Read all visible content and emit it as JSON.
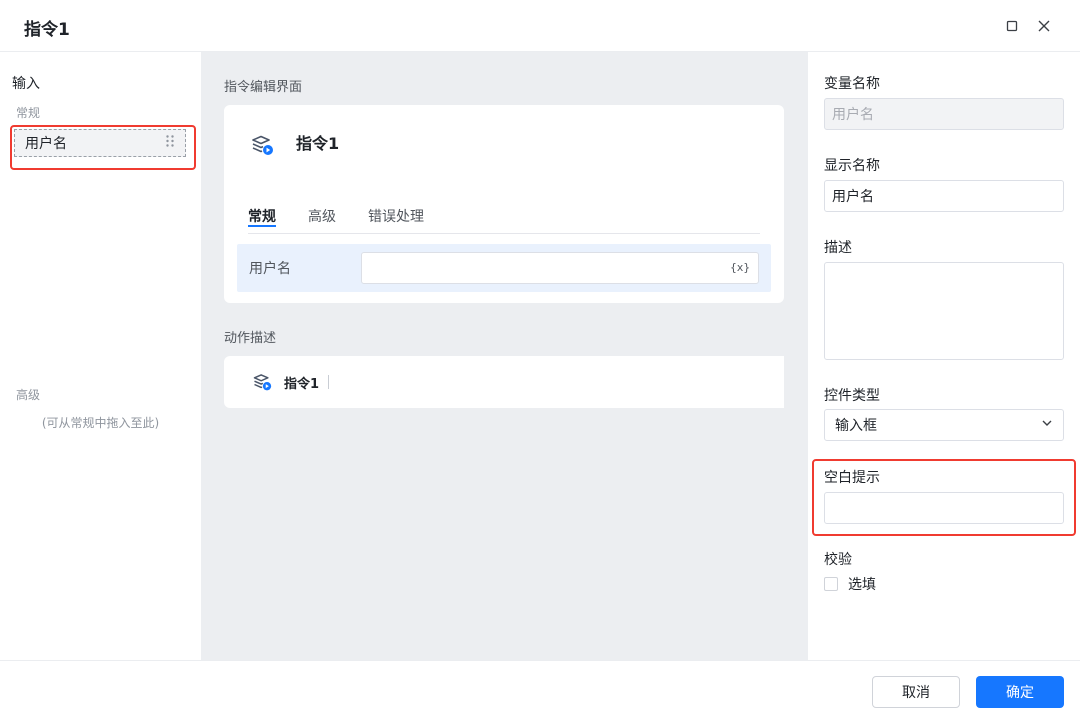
{
  "header": {
    "title": "指令1"
  },
  "left_panel": {
    "title": "输入",
    "section_normal": "常规",
    "fields": [
      {
        "label": "用户名"
      }
    ],
    "section_advanced": "高级",
    "advanced_hint": "(可从常规中拖入至此)"
  },
  "center": {
    "edit_section_label": "指令编辑界面",
    "command_name": "指令1",
    "tabs": [
      {
        "label": "常规"
      },
      {
        "label": "高级"
      },
      {
        "label": "错误处理"
      }
    ],
    "active_tab": "常规",
    "form_field_label": "用户名",
    "form_field_value": "",
    "variable_icon": "{x}",
    "desc_section_label": "动作描述",
    "desc_command_name": "指令1"
  },
  "right_panel": {
    "var_name_label": "变量名称",
    "var_name_value": "用户名",
    "display_name_label": "显示名称",
    "display_name_value": "用户名",
    "description_label": "描述",
    "description_value": "",
    "control_type_label": "控件类型",
    "control_type_value": "输入框",
    "placeholder_label": "空白提示",
    "placeholder_value": "",
    "validation_label": "校验",
    "optional_label": "选填",
    "optional_checked": false
  },
  "footer": {
    "cancel_label": "取消",
    "ok_label": "确定"
  },
  "colors": {
    "accent": "#1677ff",
    "highlight": "#f03b30",
    "tab_active_bg": "#e9f1fd"
  }
}
